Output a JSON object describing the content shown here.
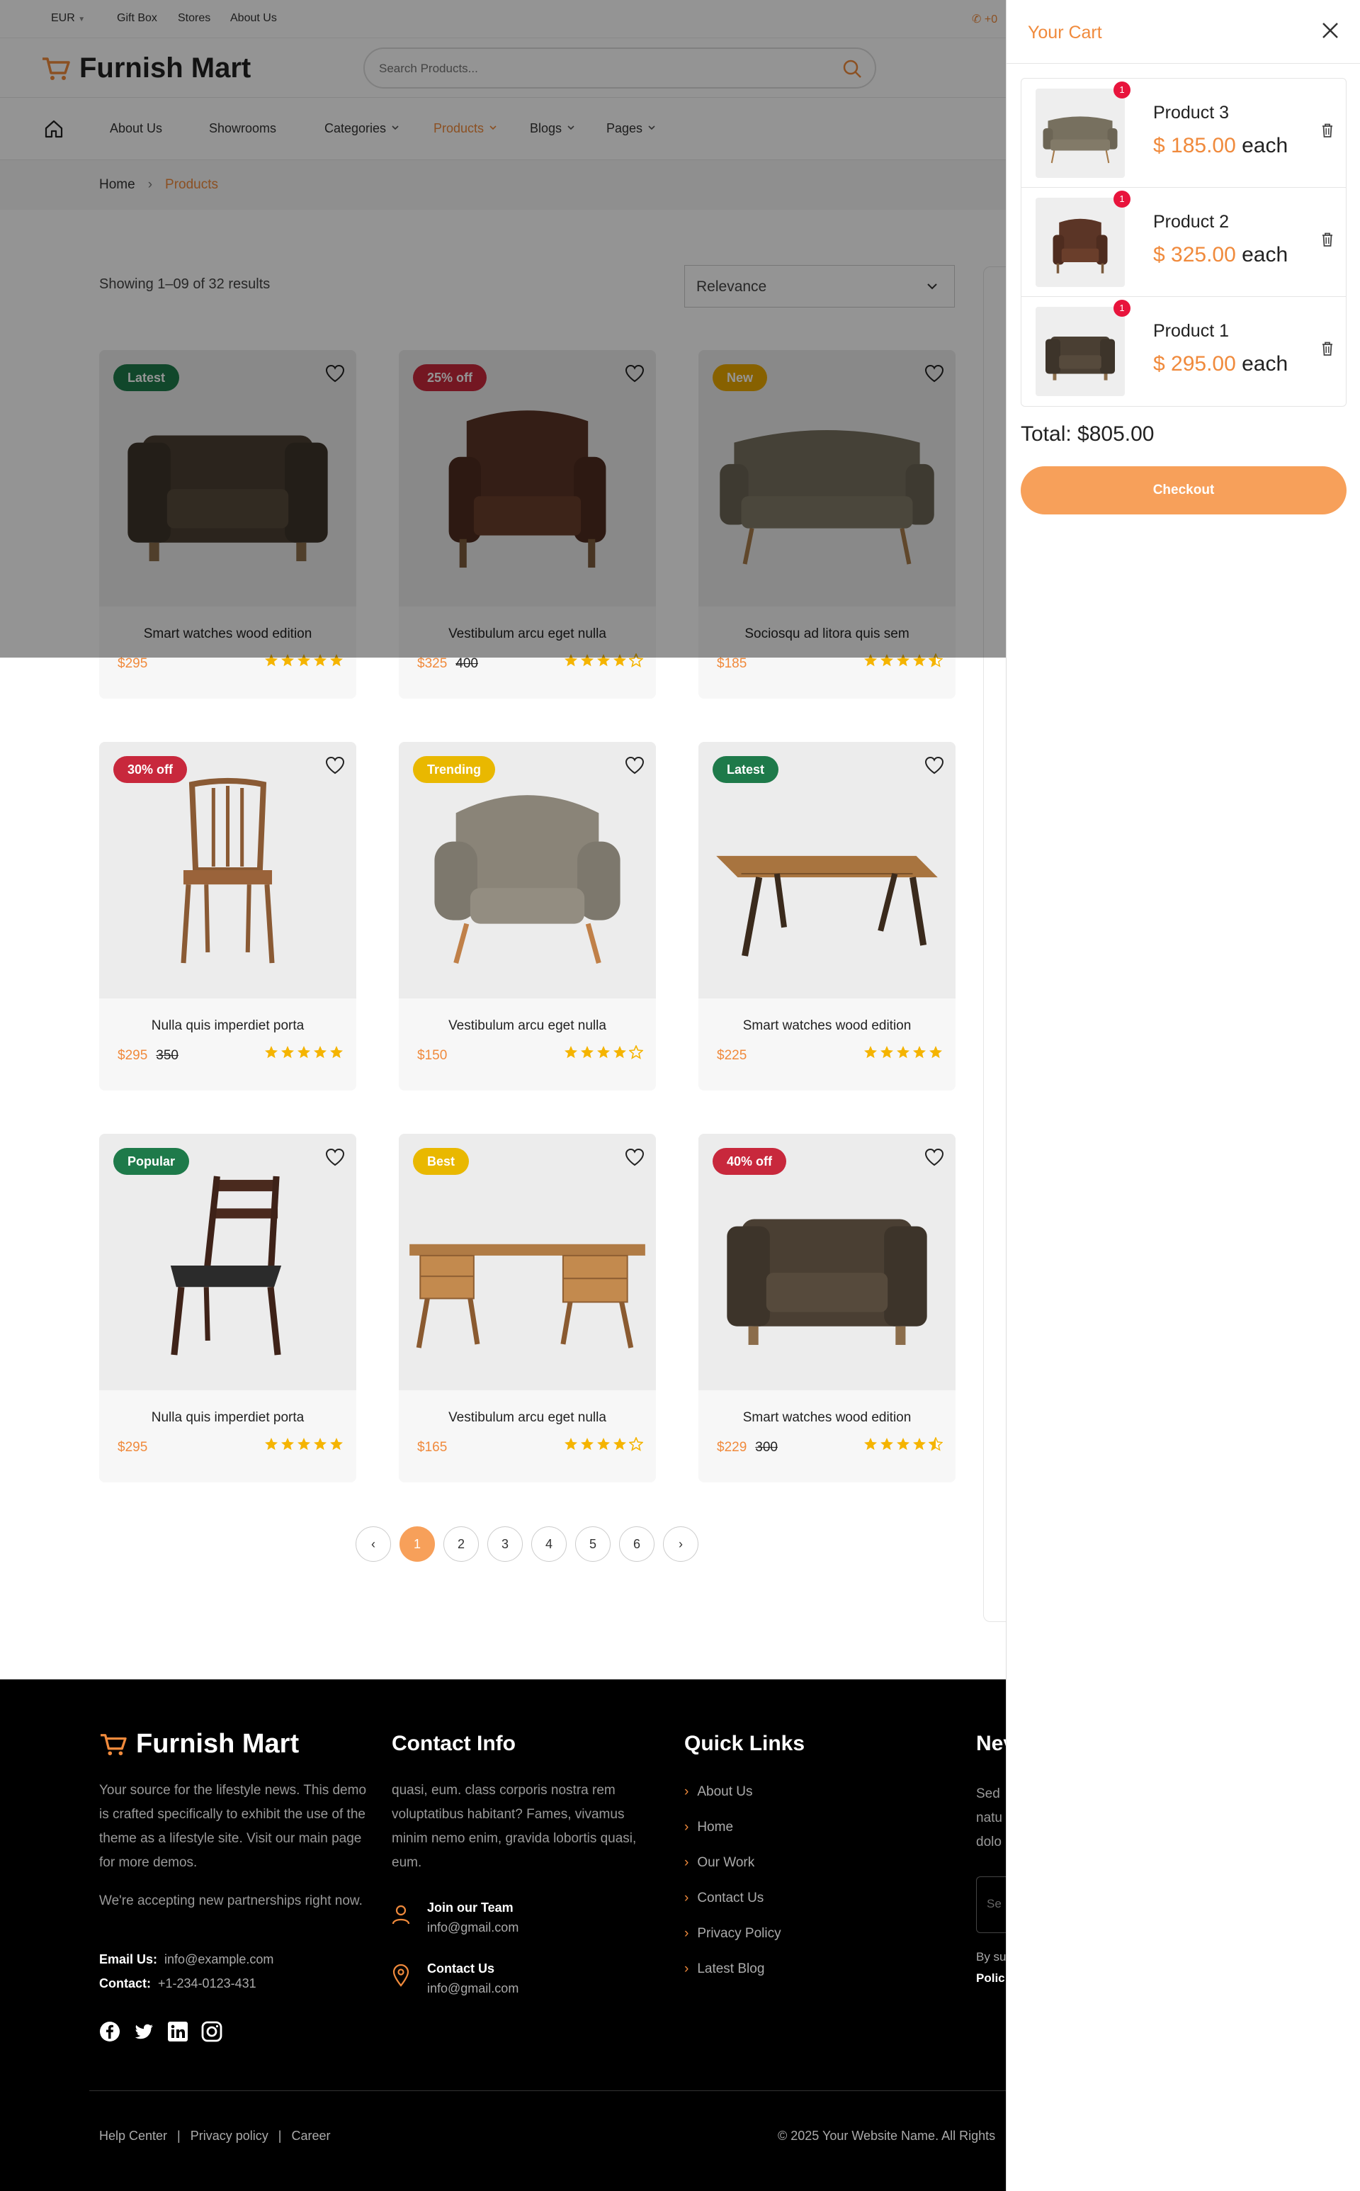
{
  "topbar": {
    "currency": "EUR",
    "links": [
      "Gift Box",
      "Stores",
      "About Us"
    ],
    "phone": "+0"
  },
  "brand": {
    "name": "Furnish Mart"
  },
  "search": {
    "placeholder": "Search Products..."
  },
  "nav": {
    "items": [
      {
        "label": "About Us",
        "dropdown": false,
        "active": false
      },
      {
        "label": "Showrooms",
        "dropdown": false,
        "active": false
      },
      {
        "label": "Categories",
        "dropdown": true,
        "active": false
      },
      {
        "label": "Products",
        "dropdown": true,
        "active": true
      },
      {
        "label": "Blogs",
        "dropdown": true,
        "active": false
      },
      {
        "label": "Pages",
        "dropdown": true,
        "active": false
      }
    ]
  },
  "breadcrumb": {
    "home": "Home",
    "current": "Products"
  },
  "listing": {
    "results_text": "Showing 1–09 of 32 results",
    "sort_value": "Relevance"
  },
  "products": [
    {
      "badge": "Latest",
      "badge_color": "#1e7a4a",
      "title": "Smart watches wood edition",
      "price": "$295",
      "old_price": "",
      "rating": 5,
      "kind": "armchair-dark"
    },
    {
      "badge": "25% off",
      "badge_color": "#c8283c",
      "title": "Vestibulum arcu eget nulla",
      "price": "$325",
      "old_price": "400",
      "rating": 4,
      "kind": "armchair-leather"
    },
    {
      "badge": "New",
      "badge_color": "#e9a800",
      "title": "Sociosqu ad litora quis sem",
      "price": "$185",
      "old_price": "",
      "rating": 4.5,
      "kind": "sofa"
    },
    {
      "badge": "30% off",
      "badge_color": "#c8283c",
      "title": "Nulla quis imperdiet porta",
      "price": "$295",
      "old_price": "350",
      "rating": 5,
      "kind": "chair-wood"
    },
    {
      "badge": "Trending",
      "badge_color": "#e9b800",
      "title": "Vestibulum arcu eget nulla",
      "price": "$150",
      "old_price": "",
      "rating": 4,
      "kind": "armchair-grey"
    },
    {
      "badge": "Latest",
      "badge_color": "#1e7a4a",
      "title": "Smart watches wood edition",
      "price": "$225",
      "old_price": "",
      "rating": 5,
      "kind": "table"
    },
    {
      "badge": "Popular",
      "badge_color": "#1e7a4a",
      "title": "Nulla quis imperdiet porta",
      "price": "$295",
      "old_price": "",
      "rating": 5,
      "kind": "chair-dark"
    },
    {
      "badge": "Best",
      "badge_color": "#e9b800",
      "title": "Vestibulum arcu eget nulla",
      "price": "$165",
      "old_price": "",
      "rating": 4,
      "kind": "desk"
    },
    {
      "badge": "40% off",
      "badge_color": "#c8283c",
      "title": "Smart watches wood edition",
      "price": "$229",
      "old_price": "300",
      "rating": 4.5,
      "kind": "armchair-dark"
    }
  ],
  "pagination": {
    "pages": [
      "1",
      "2",
      "3",
      "4",
      "5",
      "6"
    ],
    "current": "1"
  },
  "footer": {
    "about": "Your source for the lifestyle news. This demo is crafted specifically to exhibit the use of the theme as a lifestyle site. Visit our main page for more demos.",
    "partnerships": "We're accepting new partnerships right now.",
    "email_label": "Email Us:",
    "email": "info@example.com",
    "contact_label": "Contact:",
    "contact": "+1-234-0123-431",
    "contact_heading": "Contact Info",
    "contact_text": "quasi, eum. class corporis nostra rem voluptatibus habitant? Fames, vivamus minim nemo enim, gravida lobortis quasi, eum.",
    "join_title": "Join our Team",
    "join_email": "info@gmail.com",
    "contact_us_title": "Contact Us",
    "contact_us_email": "info@gmail.com",
    "quick_heading": "Quick Links",
    "quick_links": [
      "About Us",
      "Home",
      "Our Work",
      "Contact Us",
      "Privacy Policy",
      "Latest Blog"
    ],
    "news_heading": "Nev",
    "news_text": [
      "Sed",
      "natu",
      "dolo"
    ],
    "news_input_placeholder": "Se",
    "news_by": "By su",
    "news_policy": "Polic",
    "bottom_links": [
      "Help Center",
      "Privacy policy",
      "Career"
    ],
    "copyright": "© 2025 Your Website Name. All Rights"
  },
  "cart": {
    "title": "Your Cart",
    "items": [
      {
        "name": "Product 3",
        "price": "$ 185.00",
        "each": "each",
        "qty": "1",
        "kind": "sofa"
      },
      {
        "name": "Product 2",
        "price": "$ 325.00",
        "each": "each",
        "qty": "1",
        "kind": "armchair-leather"
      },
      {
        "name": "Product 1",
        "price": "$ 295.00",
        "each": "each",
        "qty": "1",
        "kind": "armchair-dark"
      }
    ],
    "total": "Total: $805.00",
    "checkout": "Checkout"
  },
  "colors": {
    "accent": "#f08a3c",
    "button": "#f7a05a",
    "badge_qty": "#e8143c",
    "star": "#f5b400"
  }
}
